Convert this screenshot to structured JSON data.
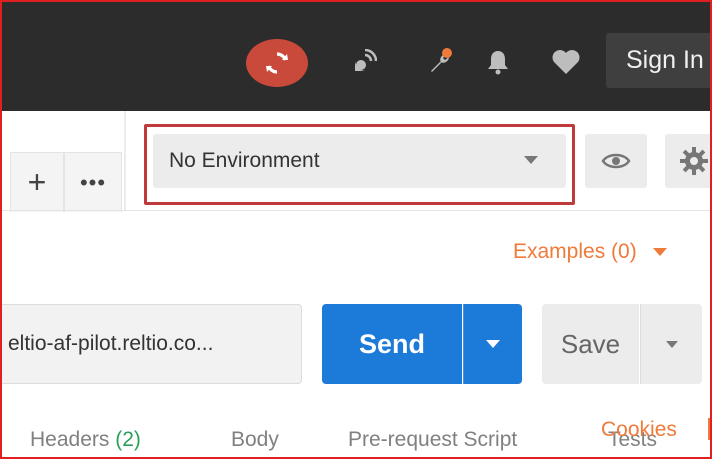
{
  "header": {
    "sync_icon": "sync-icon",
    "icons": [
      "satellite-icon",
      "wrench-icon",
      "bell-icon",
      "heart-icon"
    ],
    "notification_dot_color": "#f07a3a",
    "sign_in_label": "Sign In"
  },
  "tabs": {
    "add_label": "+",
    "more_label": "•••"
  },
  "environment": {
    "selected": "No Environment",
    "quick_look_icon": "eye-icon",
    "settings_icon": "gear-icon"
  },
  "examples": {
    "label": "Examples (0)"
  },
  "request": {
    "url_value": "eltio-af-pilot.reltio.co...",
    "send_label": "Send",
    "save_label": "Save"
  },
  "request_tabs": {
    "headers_label": "Headers",
    "headers_count": "(2)",
    "body_label": "Body",
    "prerequest_label": "Pre-request Script",
    "tests_label": "Tests",
    "cookies_label": "Cookies"
  },
  "colors": {
    "accent_orange": "#f07a3a",
    "send_blue": "#1c7ad8",
    "sync_red": "#c94a3b",
    "highlight_red": "#c0393b"
  }
}
